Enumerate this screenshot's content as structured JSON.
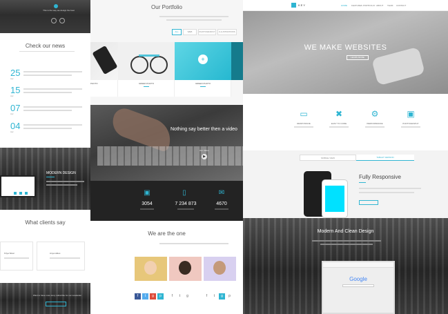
{
  "colA": {
    "hero_text": "This is the way we design the best",
    "news_title": "Check our news",
    "news": [
      {
        "day": "25",
        "mon": "Apr"
      },
      {
        "day": "15",
        "mon": "Apr"
      },
      {
        "day": "07",
        "mon": "Apr"
      },
      {
        "day": "04",
        "mon": "Apr"
      }
    ],
    "modern_design": "MODERN DESIGN",
    "clients_title": "What clients say",
    "clients": [
      {
        "name": "Kriya Silver"
      },
      {
        "name": "Anya Hides"
      }
    ],
    "footer_text": "Want to have more story subscribe for our newsletter"
  },
  "colB": {
    "portfolio_title": "Our Portfolio",
    "filters": [
      "ALL",
      "WEB",
      "PHOTOGRAPHY",
      "ILLUSTRATIONS"
    ],
    "items": [
      {
        "cap": "PHOTO"
      },
      {
        "cap": "GREEN PHOTO"
      },
      {
        "cap": "GREEN PHOTO"
      }
    ],
    "video_title": "Nothing say better then a video",
    "video_sub": "Our Video",
    "stats": [
      {
        "num": "3054"
      },
      {
        "num": "7 234 873"
      },
      {
        "num": "4670"
      }
    ],
    "team_title": "We are the one"
  },
  "colC": {
    "logo": "KEY",
    "nav": [
      "HOME",
      "FEATURES",
      "PORTFOLIO",
      "ABOUT",
      "TEAM",
      "CONTACT"
    ],
    "hero_title": "WE MAKE WEBSITES",
    "hero_button": "LEARN MORE",
    "services": [
      {
        "icon": "monitor-icon",
        "glyph": "▭",
        "label": "RESPONSIVE"
      },
      {
        "icon": "tools-icon",
        "glyph": "✖",
        "label": "EASY TO CODE"
      },
      {
        "icon": "gear-icon",
        "glyph": "⚙",
        "label": "PERFORMANCE"
      },
      {
        "icon": "camera-icon",
        "glyph": "▣",
        "label": "PHOTOGRAPHY"
      }
    ],
    "tabs": [
      "MOBILE VIEW",
      "TABLET VERSION"
    ],
    "responsive_title": "Fully Responsive",
    "modern_title": "Modern And Clean Design",
    "google": "Google"
  },
  "colors": {
    "accent": "#2fb5d2",
    "dark": "#2a2a2a"
  }
}
